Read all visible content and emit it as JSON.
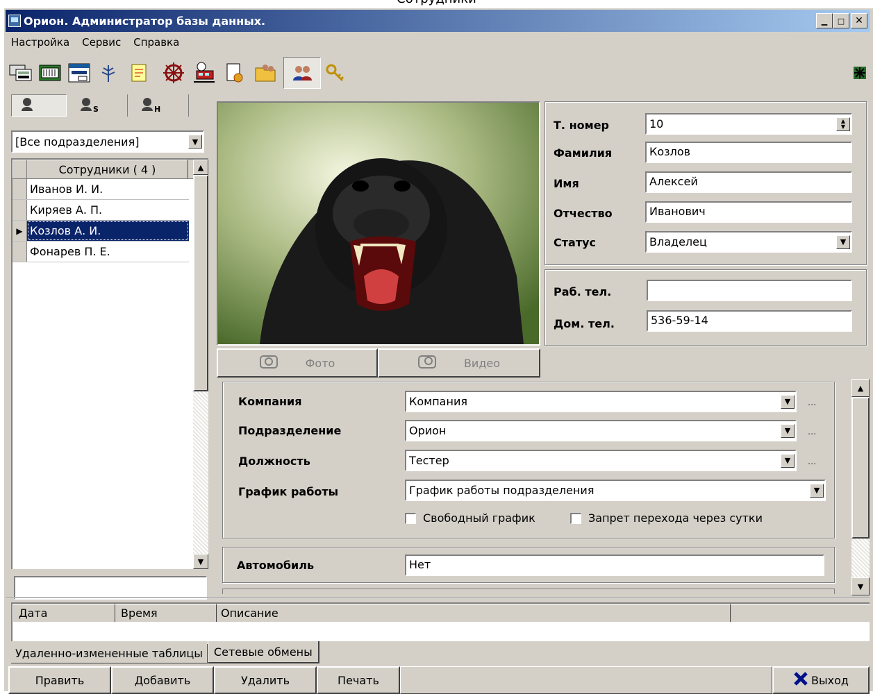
{
  "caption": "Сотрудники",
  "window": {
    "title": "Орион. Администратор базы данных."
  },
  "menu": [
    "Настройка",
    "Сервис",
    "Справка"
  ],
  "toolbar_icons": [
    "hardware-config-icon",
    "network-device-icon",
    "window-layout-icon",
    "antenna-icon",
    "document-note-icon",
    "ship-wheel-icon",
    "train-clock-icon",
    "document-certificate-icon",
    "folder-people-icon",
    "employees-icon",
    "keys-icon"
  ],
  "left": {
    "tabs": [
      "",
      "S",
      "H"
    ],
    "division_filter": "[Все подразделения]",
    "list_header": "Сотрудники ( 4 )",
    "employees": [
      "Иванов И. И.",
      "Киряев А. П.",
      "Козлов А. И.",
      "Фонарев П. Е."
    ],
    "selected_index": 2,
    "search_value": ""
  },
  "photo": {
    "foto_label": "Фото",
    "video_label": "Видео"
  },
  "person": {
    "tab_number_label": "Т. номер",
    "tab_number": "10",
    "surname_label": "Фамилия",
    "surname": "Козлов",
    "name_label": "Имя",
    "name": "Алексей",
    "patronymic_label": "Отчество",
    "patronymic": "Иванович",
    "status_label": "Статус",
    "status": "Владелец"
  },
  "phones": {
    "work_label": "Раб. тел.",
    "work": "",
    "home_label": "Дом. тел.",
    "home": "536-59-14"
  },
  "org": {
    "company_label": "Компания",
    "company": "Компания",
    "division_label": "Подразделение",
    "division": "Орион",
    "position_label": "Должность",
    "position": "Тестер",
    "schedule_label": "График работы",
    "schedule": "График работы подразделения",
    "free_schedule": "Свободный график",
    "no_day_cross": "Запрет перехода через сутки",
    "ellipsis": "..."
  },
  "car": {
    "label": "Автомобиль",
    "value": "Нет"
  },
  "log": {
    "columns": [
      "Дата",
      "Время",
      "Описание"
    ]
  },
  "bottom_tabs": [
    "Удаленно-измененные таблицы",
    "Сетевые обмены"
  ],
  "buttons": {
    "edit": "Править",
    "add": "Добавить",
    "delete": "Удалить",
    "print": "Печать",
    "exit": "Выход"
  },
  "colors": {
    "title_start": "#0a246a",
    "title_end": "#a6caf0",
    "selection": "#0a246a",
    "face": "#d4d0c8"
  }
}
